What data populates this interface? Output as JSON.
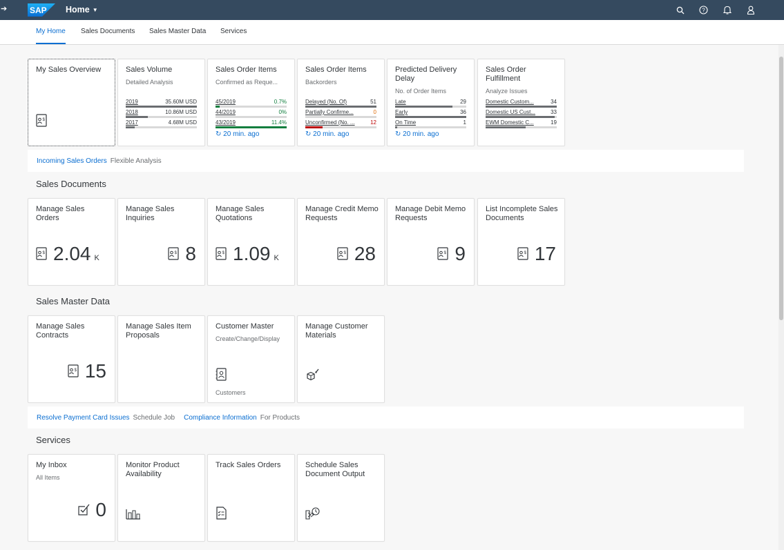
{
  "shell": {
    "title": "Home",
    "logo_text": "SAP",
    "brand_color": "#0a6ed1",
    "bar_color": "#354a5f",
    "icons": [
      "search-icon",
      "help-icon",
      "notification-icon",
      "user-icon"
    ]
  },
  "tabs": [
    {
      "label": "My Home",
      "active": true
    },
    {
      "label": "Sales Documents",
      "active": false
    },
    {
      "label": "Sales Master Data",
      "active": false
    },
    {
      "label": "Services",
      "active": false
    }
  ],
  "overview_tiles": {
    "my_sales_overview": {
      "title": "My Sales Overview"
    },
    "sales_volume": {
      "title": "Sales Volume",
      "subtitle": "Detailed Analysis",
      "rows": [
        {
          "label": "2019",
          "value": "35.60M USD",
          "fill": 1.0,
          "color": "#6a6d70"
        },
        {
          "label": "2018",
          "value": "10.86M USD",
          "fill": 0.31,
          "color": "#6a6d70"
        },
        {
          "label": "2017",
          "value": "4.68M USD",
          "fill": 0.13,
          "color": "#6a6d70"
        }
      ]
    },
    "sales_order_items_confirmed": {
      "title": "Sales Order Items",
      "subtitle": "Confirmed as Reque...",
      "rows": [
        {
          "label": "45/2019",
          "value": "0.7%",
          "fill": 0.06,
          "color": "#107e3e"
        },
        {
          "label": "44/2019",
          "value": "0%",
          "fill": 0.0,
          "color": "#107e3e"
        },
        {
          "label": "43/2019",
          "value": "11.4%",
          "fill": 1.0,
          "color": "#107e3e"
        }
      ],
      "refresh": "20 min. ago"
    },
    "sales_order_items_backorders": {
      "title": "Sales Order Items",
      "subtitle": "Backorders",
      "rows": [
        {
          "label": "Delayed (No. Of)",
          "value": "51",
          "fill": 1.0,
          "color": "#6a6d70",
          "value_color": "#32363a"
        },
        {
          "label": "Partially Confirme...",
          "value": "0",
          "fill": 0.0,
          "color": "#df6e0c",
          "value_color": "#df6e0c"
        },
        {
          "label": "Unconfirmed (No. ...",
          "value": "12",
          "fill": 0.24,
          "color": "#bb0000",
          "value_color": "#bb0000"
        }
      ],
      "refresh": "20 min. ago"
    },
    "predicted_delivery_delay": {
      "title": "Predicted Delivery Delay",
      "subtitle": "No. of Order Items",
      "rows": [
        {
          "label": "Late",
          "value": "29",
          "fill": 0.81,
          "color": "#6a6d70"
        },
        {
          "label": "Early",
          "value": "36",
          "fill": 1.0,
          "color": "#6a6d70"
        },
        {
          "label": "On Time",
          "value": "1",
          "fill": 0.03,
          "color": "#6a6d70"
        }
      ],
      "refresh": "20 min. ago"
    },
    "sales_order_fulfillment": {
      "title": "Sales Order Fulfillment",
      "subtitle": "Analyze Issues",
      "rows": [
        {
          "label": "Domestic Custom...",
          "value": "34",
          "fill": 1.0,
          "color": "#6a6d70"
        },
        {
          "label": "Domestic US Cust...",
          "value": "33",
          "fill": 0.97,
          "color": "#6a6d70"
        },
        {
          "label": "EWM Domestic C...",
          "value": "19",
          "fill": 0.56,
          "color": "#6a6d70"
        }
      ]
    }
  },
  "links_1": [
    {
      "label": "Incoming Sales Orders",
      "sub": "Flexible Analysis"
    }
  ],
  "sections": {
    "sales_documents": "Sales Documents",
    "sales_master_data": "Sales Master Data",
    "services": "Services"
  },
  "sales_doc_tiles": [
    {
      "title": "Manage Sales Orders",
      "value": "2.04",
      "scale": "K"
    },
    {
      "title": "Manage Sales Inquiries",
      "value": "8",
      "scale": ""
    },
    {
      "title": "Manage Sales Quotations",
      "value": "1.09",
      "scale": "K"
    },
    {
      "title": "Manage Credit Memo Requests",
      "value": "28",
      "scale": ""
    },
    {
      "title": "Manage Debit Memo Requests",
      "value": "9",
      "scale": ""
    },
    {
      "title": "List Incomplete Sales Documents",
      "value": "17",
      "scale": ""
    }
  ],
  "master_tiles": [
    {
      "title": "Manage Sales Contracts",
      "value": "15"
    },
    {
      "title": "Manage Sales Item Proposals"
    },
    {
      "title": "Customer Master",
      "subtitle": "Create/Change/Display",
      "footer": "Customers"
    },
    {
      "title": "Manage Customer Materials"
    }
  ],
  "links_2": [
    {
      "label": "Resolve Payment Card Issues",
      "sub": "Schedule Job"
    },
    {
      "label": "Compliance Information",
      "sub": "For Products"
    }
  ],
  "service_tiles": [
    {
      "title": "My Inbox",
      "subtitle": "All Items",
      "value": "0"
    },
    {
      "title": "Monitor Product Availability"
    },
    {
      "title": "Track Sales Orders"
    },
    {
      "title": "Schedule Sales Document Output"
    }
  ]
}
